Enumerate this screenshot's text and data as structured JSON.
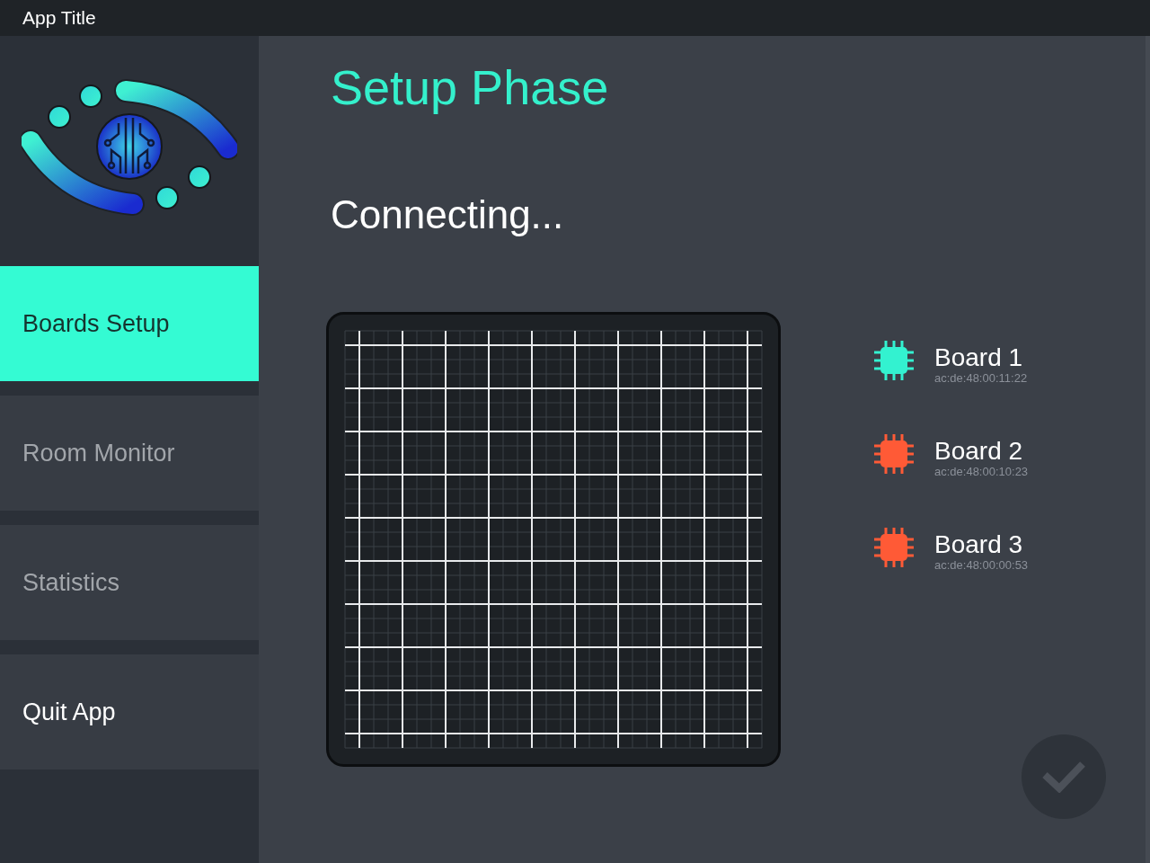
{
  "window": {
    "title": "App Title"
  },
  "sidebar": {
    "items": [
      {
        "label": "Boards Setup",
        "selected": true,
        "disabled": false
      },
      {
        "label": "Room Monitor",
        "selected": false,
        "disabled": true
      },
      {
        "label": "Statistics",
        "selected": false,
        "disabled": true
      },
      {
        "label": "Quit App",
        "selected": false,
        "disabled": false
      }
    ]
  },
  "main": {
    "title": "Setup Phase",
    "status": "Connecting..."
  },
  "boards": [
    {
      "name": "Board 1",
      "mac": "ac:de:48:00:11:22",
      "color": "#33f2d0"
    },
    {
      "name": "Board 2",
      "mac": "ac:de:48:00:10:23",
      "color": "#ff5a36"
    },
    {
      "name": "Board 3",
      "mac": "ac:de:48:00:00:53",
      "color": "#ff5a36"
    }
  ],
  "confirm_button": {
    "disabled": true
  }
}
